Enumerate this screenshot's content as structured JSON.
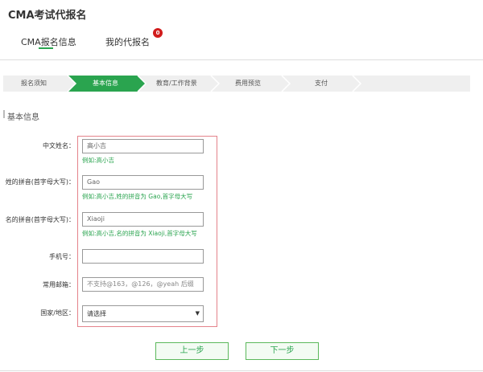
{
  "header": {
    "title": "CMA考试代报名"
  },
  "tabs": [
    {
      "label": "CMA报名信息",
      "active": true
    },
    {
      "label": "我的代报名",
      "badge": "0"
    }
  ],
  "steps": [
    {
      "label": "报名须知",
      "active": false
    },
    {
      "label": "基本信息",
      "active": true
    },
    {
      "label": "教育/工作背景",
      "active": false
    },
    {
      "label": "费用预览",
      "active": false
    },
    {
      "label": "支付",
      "active": false
    }
  ],
  "section": {
    "title": "基本信息"
  },
  "form": {
    "chinese_name": {
      "label": "中文姓名：",
      "value": "高小吉",
      "hint": "例如:高小吉"
    },
    "surname_pinyin": {
      "label": "姓的拼音(首字母大写)：",
      "value": "Gao",
      "hint": "例如:高小吉,姓的拼音为 Gao,首字母大写"
    },
    "given_pinyin": {
      "label": "名的拼音(首字母大写)：",
      "value": "Xiaoji",
      "hint": "例如:高小吉,名的拼音为 Xiaoji,首字母大写"
    },
    "phone": {
      "label": "手机号：",
      "value": ""
    },
    "email": {
      "label": "常用邮箱：",
      "placeholder": "不支持@163，@126，@yeah 后缀"
    },
    "country": {
      "label": "国家/地区：",
      "selected": "请选择"
    }
  },
  "buttons": {
    "prev": "上一步",
    "next": "下一步"
  },
  "colors": {
    "accent": "#2aa44f",
    "badge": "#d11c1c",
    "form_border": "#e4838b"
  }
}
